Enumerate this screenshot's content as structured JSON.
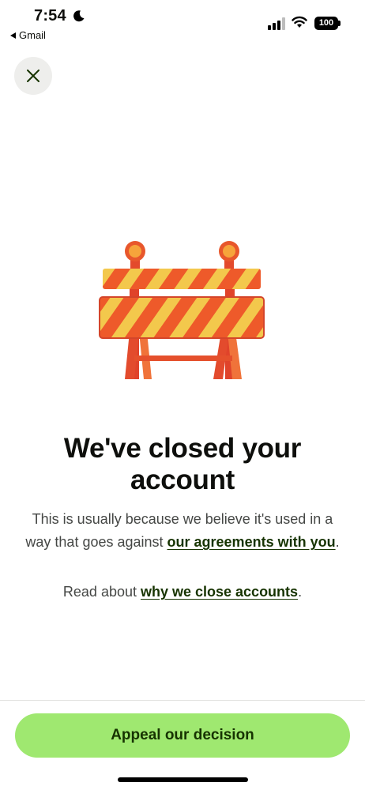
{
  "status_bar": {
    "time": "7:54",
    "back_app": "Gmail",
    "battery": "100"
  },
  "close_button": {
    "icon": "close-icon"
  },
  "illustration": {
    "icon": "road-barrier-illustration"
  },
  "title": "We've closed your account",
  "description": {
    "before": "This is usually because we believe it's used in a way that goes against ",
    "link": "our agreements with you",
    "after": "."
  },
  "read_about": {
    "before": "Read about ",
    "link": "why we close accounts",
    "after": "."
  },
  "footer": {
    "appeal_label": "Appeal our decision"
  },
  "colors": {
    "accent": "#9fe870",
    "link": "#163300",
    "title": "#0e0f0c",
    "body_text": "#454745"
  }
}
